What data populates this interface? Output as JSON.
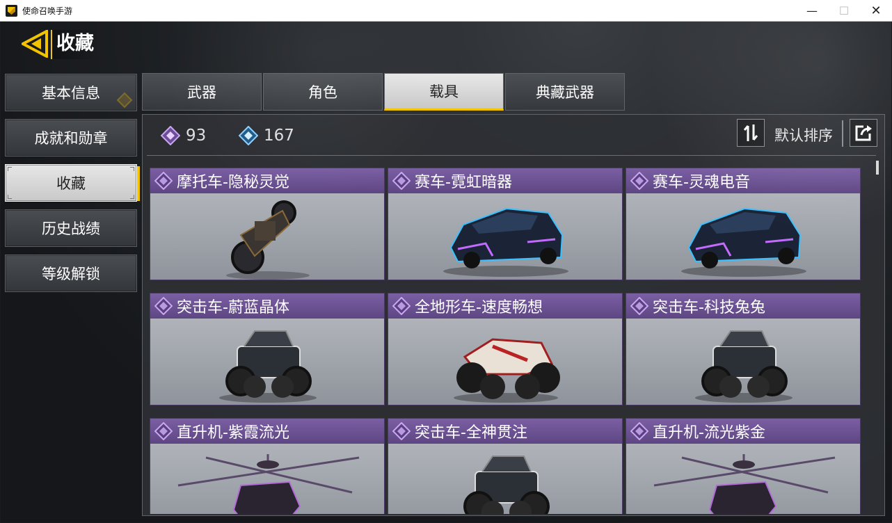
{
  "window": {
    "title": "使命召唤手游",
    "min": "—",
    "max": "☐",
    "close": "✕"
  },
  "header": {
    "title": "收藏"
  },
  "sidebar": {
    "items": [
      {
        "label": "基本信息",
        "active": false
      },
      {
        "label": "成就和勋章",
        "active": false
      },
      {
        "label": "收藏",
        "active": true
      },
      {
        "label": "历史战绩",
        "active": false
      },
      {
        "label": "等级解锁",
        "active": false
      }
    ]
  },
  "tabs": [
    {
      "label": "武器",
      "active": false
    },
    {
      "label": "角色",
      "active": false
    },
    {
      "label": "载具",
      "active": true
    },
    {
      "label": "典藏武器",
      "active": false
    }
  ],
  "stats": {
    "epic_count": "93",
    "rare_count": "167"
  },
  "sort": {
    "label": "默认排序"
  },
  "colors": {
    "accent": "#f2c400",
    "epic": "#7a5fa3",
    "rare": "#4aa3e0"
  },
  "vehicles": [
    {
      "name": "摩托车-隐秘灵觉",
      "kind": "motorcycle",
      "rarity": "epic"
    },
    {
      "name": "赛车-霓虹暗器",
      "kind": "car",
      "rarity": "epic"
    },
    {
      "name": "赛车-灵魂电音",
      "kind": "car",
      "rarity": "epic"
    },
    {
      "name": "突击车-蔚蓝晶体",
      "kind": "buggy",
      "rarity": "epic"
    },
    {
      "name": "全地形车-速度畅想",
      "kind": "atv",
      "rarity": "epic"
    },
    {
      "name": "突击车-科技兔兔",
      "kind": "buggy",
      "rarity": "epic"
    },
    {
      "name": "直升机-紫霞流光",
      "kind": "helicopter",
      "rarity": "epic"
    },
    {
      "name": "突击车-全神贯注",
      "kind": "buggy",
      "rarity": "epic"
    },
    {
      "name": "直升机-流光紫金",
      "kind": "helicopter",
      "rarity": "epic"
    }
  ]
}
